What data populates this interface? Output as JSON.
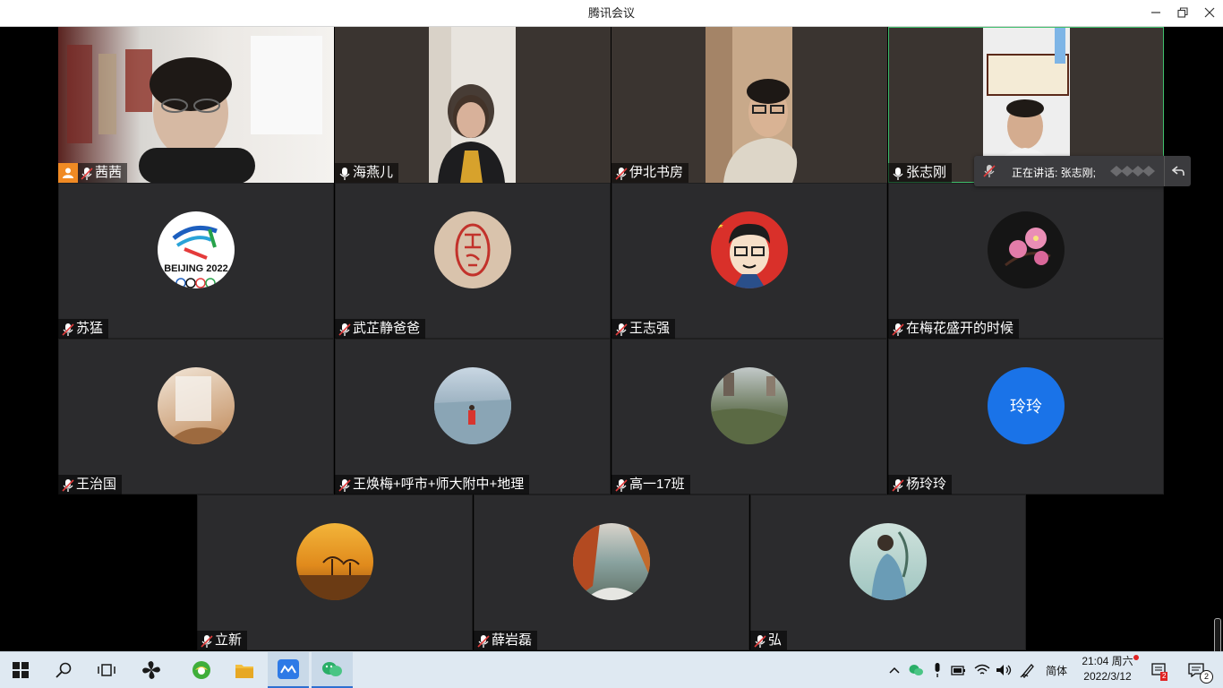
{
  "window": {
    "title": "腾讯会议"
  },
  "participants": [
    {
      "name": "茜茜",
      "host": true
    },
    {
      "name": "海燕儿"
    },
    {
      "name": "伊北书房"
    },
    {
      "name": "张志刚"
    },
    {
      "name": "苏猛"
    },
    {
      "name": "武芷静爸爸"
    },
    {
      "name": "王志强"
    },
    {
      "name": "在梅花盛开的时候"
    },
    {
      "name": "王治国"
    },
    {
      "name": "王焕梅+呼市+师大附中+地理"
    },
    {
      "name": "高一17班"
    },
    {
      "name": "杨玲玲",
      "avatar_text": "玲玲",
      "avatar_color": "#1a73e8"
    },
    {
      "name": "立新"
    },
    {
      "name": "薛岩磊"
    },
    {
      "name": "弘"
    }
  ],
  "beijing_logo_text": "BEIJING 2022",
  "speaking": {
    "text": "正在讲话: 张志刚;"
  },
  "taskbar": {
    "ime": "简体",
    "time": "21:04 周六",
    "date": "2022/3/12",
    "badge_count": "2",
    "notification_count": "2"
  },
  "colors": {
    "active_border": "#3fbf6c",
    "host_badge": "#f08a24",
    "accent": "#2f6fd1"
  }
}
